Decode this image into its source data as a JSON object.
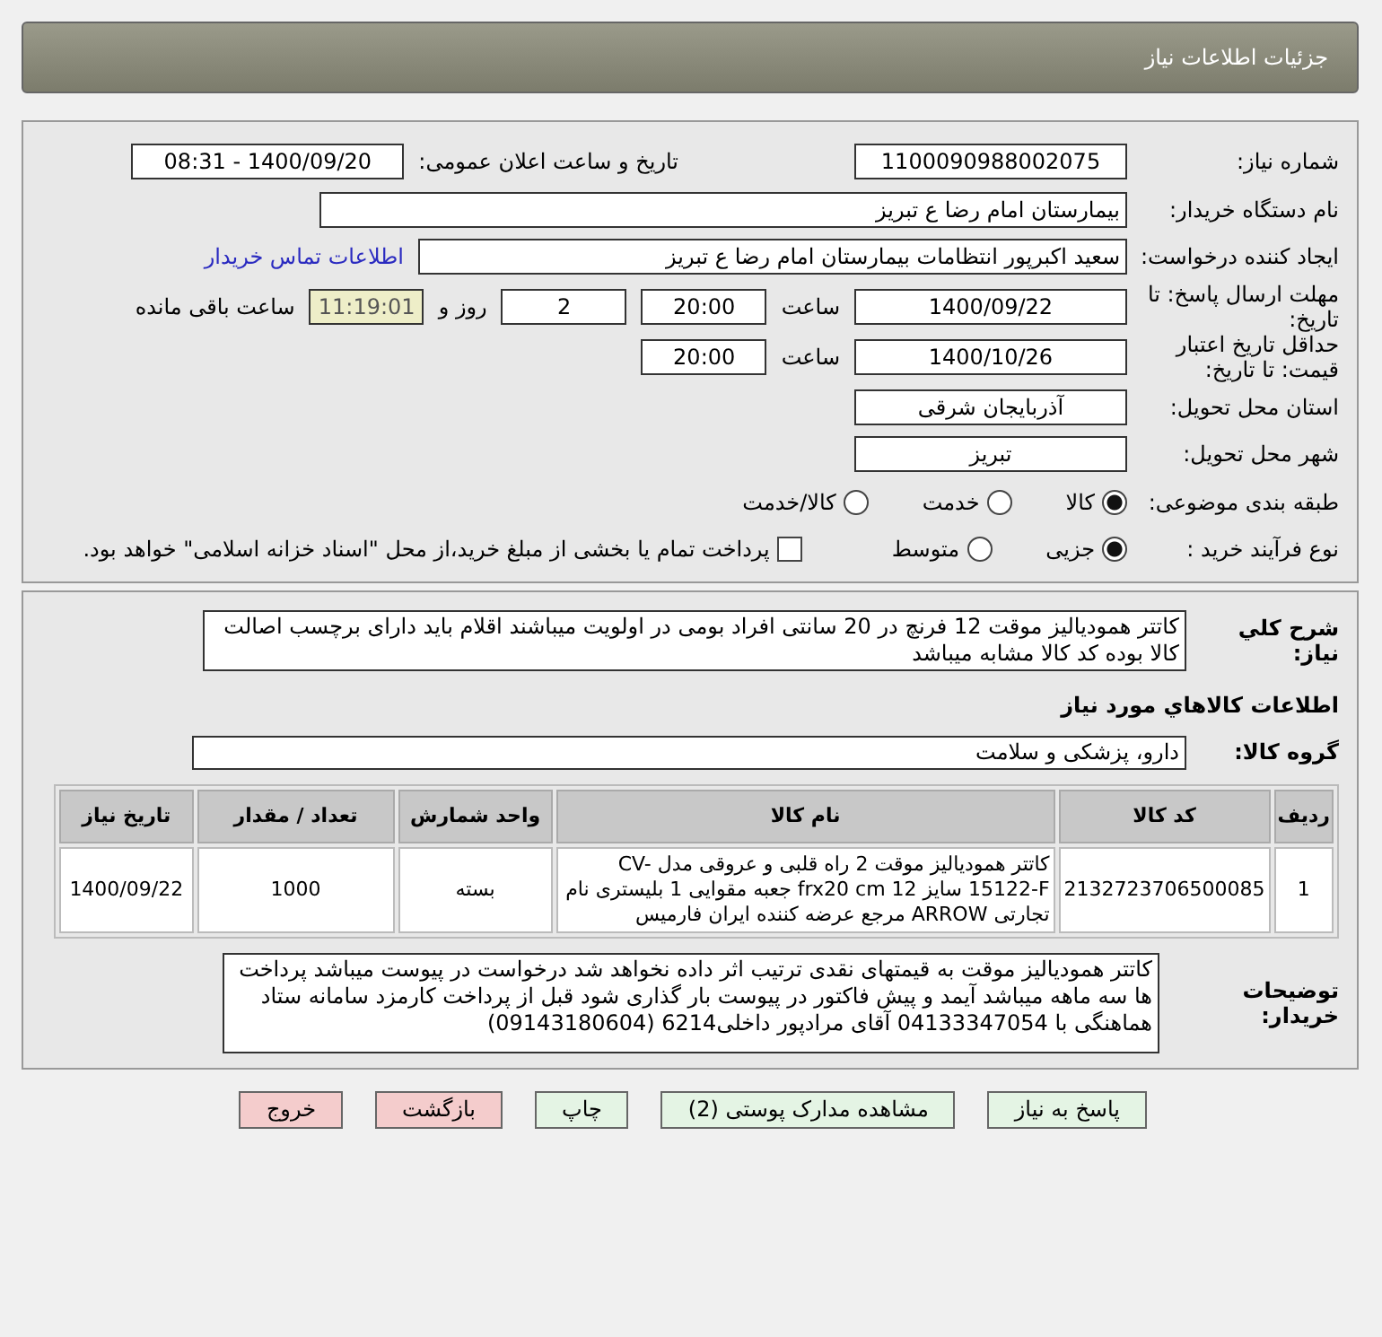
{
  "header": {
    "title": "جزئیات اطلاعات نیاز"
  },
  "rows": [
    {
      "label": "شماره نیاز:",
      "cells": [
        {
          "kind": "field",
          "text": "1100090988002075"
        },
        {
          "kind": "gaptext",
          "text": "تاریخ و ساعت اعلان عمومی:"
        },
        {
          "kind": "field",
          "text": "1400/09/20 - 08:31"
        }
      ]
    },
    {
      "label": "نام دستگاه خریدار:",
      "cells": [
        {
          "kind": "wide",
          "text": "بیمارستان امام رضا  ع  تبریز"
        }
      ]
    },
    {
      "label": "ایجاد کننده درخواست:",
      "cells": [
        {
          "kind": "long",
          "text": "سعید اکبرپور انتظامات بیمارستان امام رضا  ع  تبریز"
        },
        {
          "kind": "link",
          "text": "اطلاعات تماس خریدار"
        }
      ]
    },
    {
      "label": "مهلت ارسال پاسخ: تا تاریخ:",
      "cells": [
        {
          "kind": "field",
          "text": "1400/09/22"
        },
        {
          "kind": "text",
          "text": "ساعت"
        },
        {
          "kind": "short",
          "text": "20:00"
        },
        {
          "kind": "short",
          "text": "2"
        },
        {
          "kind": "text",
          "text": "روز و"
        },
        {
          "kind": "timer",
          "text": "11:19:01"
        },
        {
          "kind": "text",
          "text": "ساعت باقی مانده"
        }
      ]
    },
    {
      "label": "حداقل تاریخ اعتبار قیمت: تا تاریخ:",
      "cells": [
        {
          "kind": "field",
          "text": "1400/10/26"
        },
        {
          "kind": "text",
          "text": "ساعت"
        },
        {
          "kind": "short",
          "text": "20:00"
        }
      ]
    },
    {
      "label": "استان محل تحویل:",
      "cells": [
        {
          "kind": "field",
          "text": "آذربایجان شرقی"
        }
      ]
    },
    {
      "label": "شهر محل تحویل:",
      "cells": [
        {
          "kind": "field",
          "text": "تبریز"
        }
      ]
    },
    {
      "label": "طبقه بندی موضوعی:",
      "cells": [
        {
          "kind": "radio",
          "text": "کالا",
          "selected": true
        },
        {
          "kind": "radio",
          "text": "خدمت",
          "selected": false
        },
        {
          "kind": "radio",
          "text": "کالا/خدمت",
          "selected": false
        }
      ]
    },
    {
      "label": "نوع فرآیند خرید :",
      "cells": [
        {
          "kind": "radio",
          "text": "جزیی",
          "selected": true
        },
        {
          "kind": "radio",
          "text": "متوسط",
          "selected": false
        },
        {
          "kind": "checkbox",
          "text": "پرداخت تمام یا بخشی از مبلغ خرید،از محل \"اسناد خزانه اسلامی\" خواهد بود.",
          "checked": false
        }
      ]
    }
  ],
  "description": {
    "label": "شرح کلي نياز:",
    "text": "کاتتر همودیالیز موقت 12 فرنچ در 20 سانتی افراد بومی در اولویت میباشند اقلام باید دارای برچسب اصالت کالا بوده کد کالا مشابه میباشد"
  },
  "goods_heading": "اطلاعات کالاهاي مورد نياز",
  "goods_group": {
    "label": "گروه کالا:",
    "value": "دارو، پزشکی و سلامت"
  },
  "table": {
    "columns": [
      "ردیف",
      "کد کالا",
      "نام کالا",
      "واحد شمارش",
      "تعداد / مقدار",
      "تاریخ نیاز"
    ],
    "rows": [
      [
        "1",
        "2132723706500085",
        "کاتتر همودیالیز موقت 2 راه قلبی و عروقی مدل CV-15122-F سایز 12 frx20 cm جعبه مقوایی 1 بلیستری نام تجارتی ARROW مرجع عرضه کننده ایران فارمیس",
        "بسته",
        "1000",
        "1400/09/22"
      ]
    ]
  },
  "buyer_notes": {
    "label": "توضیحات خریدار:",
    "text": "کاتتر همودیالیز موقت به قیمتهای نقدی ترتیب اثر داده نخواهد شد درخواست در پیوست میباشد پرداخت ها سه ماهه میباشد آیمد و پیش فاکتور در پیوست بار گذاری شود قبل از پرداخت کارمزد سامانه ستاد هماهنگی با 04133347054  آقای مرادپور داخلی6214 (09143180604)"
  },
  "buttons": [
    {
      "kind": "primary",
      "label": "پاسخ به نیاز"
    },
    {
      "kind": "primary",
      "label": "مشاهده مدارک پوستی (2)"
    },
    {
      "kind": "primary",
      "label": "چاپ"
    },
    {
      "kind": "danger",
      "label": "بازگشت"
    },
    {
      "kind": "danger",
      "label": "خروج"
    }
  ]
}
